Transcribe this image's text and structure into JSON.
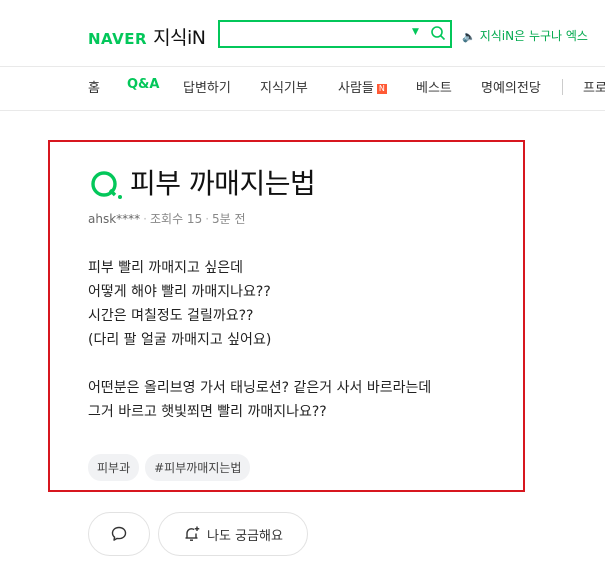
{
  "header": {
    "logo_naver": "NAVER",
    "logo_kin": "지식iN",
    "search_value": "",
    "notice": "지식iN은 누구나 엑스"
  },
  "nav": {
    "items": [
      "홈",
      "Q&A",
      "답변하기",
      "지식기부",
      "사람들",
      "베스트",
      "명예의전당",
      "프로"
    ],
    "active": "Q&A",
    "new_badge": "N"
  },
  "question": {
    "q_letter": "Q.",
    "title": "피부 까매지는법",
    "author": "ahsk****",
    "views": "조회수 15",
    "time": "5분 전",
    "body_lines": [
      "피부 빨리 까매지고 싶은데",
      "어떻게 해야 빨리 까매지나요??",
      "시간은 며칠정도 걸릴까요??",
      "(다리 팔 얼굴 까매지고 싶어요)",
      "",
      "어떤분은 올리브영 가서 태닝로션? 같은거 사서 바르라는데",
      "그거 바르고 햇빛쬐면 빨리 까매지나요??"
    ],
    "tags": [
      "피부과",
      "#피부까매지는법"
    ]
  },
  "actions": {
    "curious_label": "나도 궁금해요"
  },
  "colors": {
    "brand": "#03c75a",
    "highlight_border": "#d7171f"
  }
}
